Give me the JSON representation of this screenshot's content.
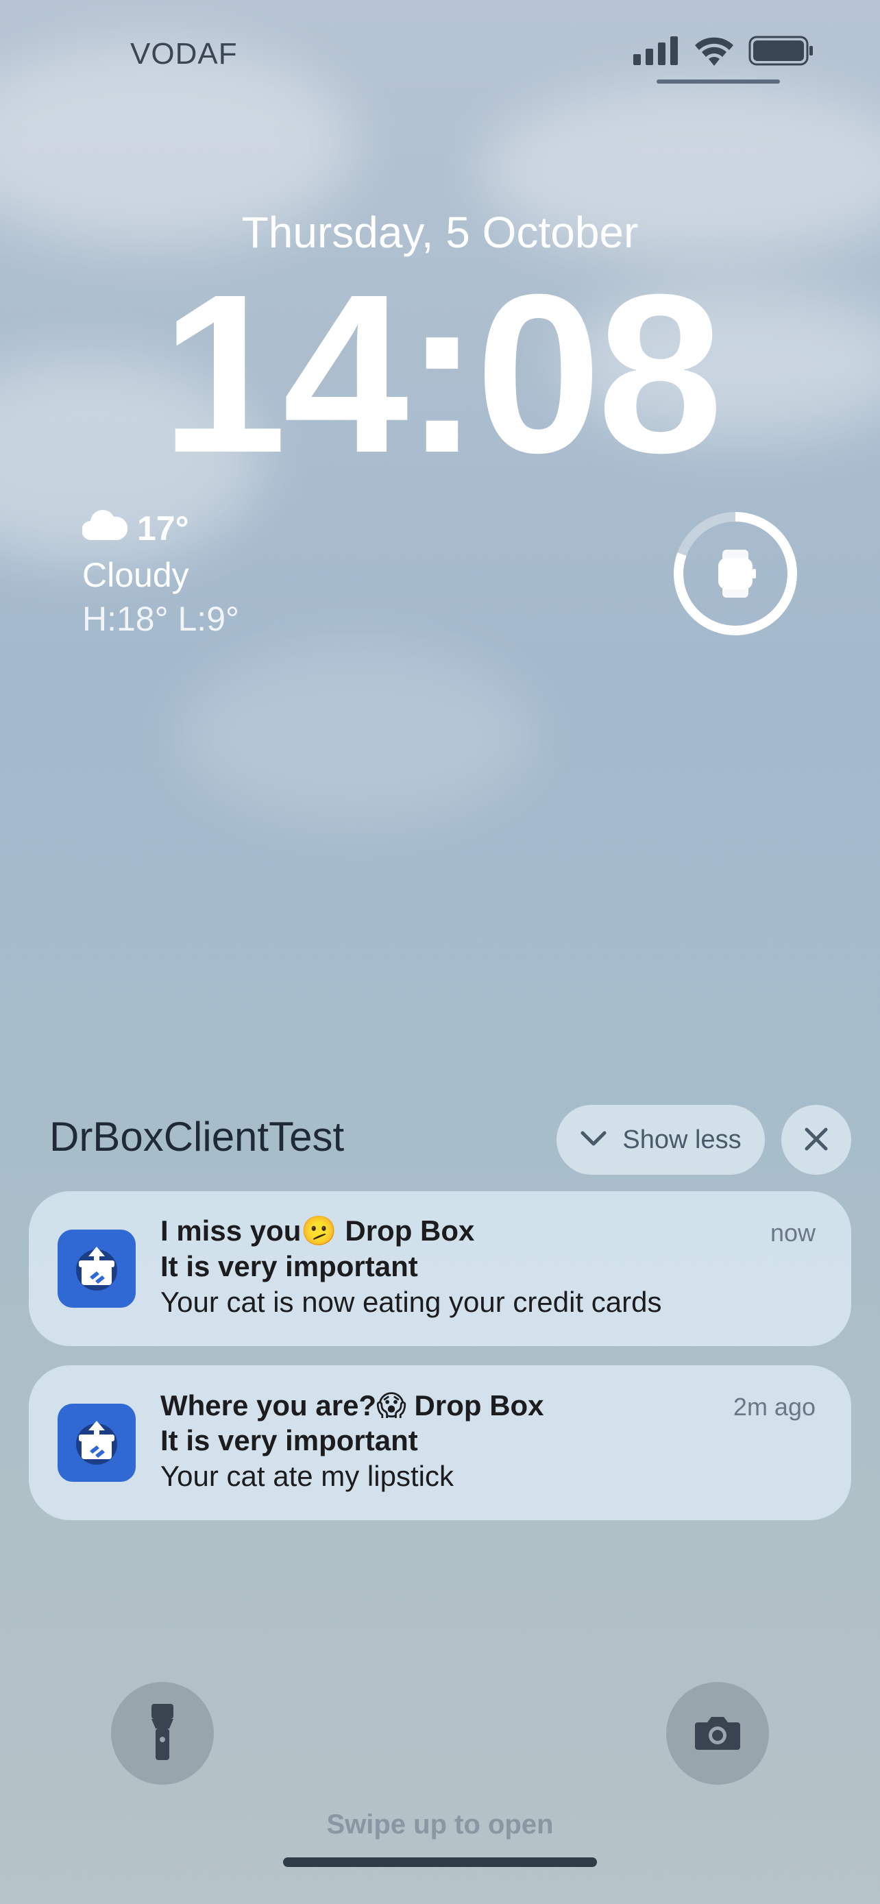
{
  "status_bar": {
    "carrier": "VODAF",
    "icons": [
      "cellular-signal-icon",
      "wifi-icon",
      "battery-icon"
    ]
  },
  "lock_screen": {
    "date": "Thursday, 5 October",
    "time": "14:08"
  },
  "weather": {
    "icon": "cloud-icon",
    "temperature": "17°",
    "condition": "Cloudy",
    "high_low": "H:18° L:9°"
  },
  "widget": {
    "icon": "watch-icon"
  },
  "notification_group": {
    "app_name": "DrBoxClientTest",
    "show_less_label": "Show less",
    "show_less_icon": "chevron-down-icon",
    "close_icon": "close-icon"
  },
  "notifications": [
    {
      "title": "I miss you🫤 Drop Box",
      "subtitle": "It is very important",
      "body": "Your cat is now eating your credit cards",
      "time": "now",
      "icon": "app-box-icon"
    },
    {
      "title": "Where you are?😱 Drop Box",
      "subtitle": "It is very important",
      "body": "Your cat ate my lipstick",
      "time": "2m ago",
      "icon": "app-box-icon"
    }
  ],
  "bottom": {
    "flashlight_icon": "flashlight-icon",
    "camera_icon": "camera-icon",
    "swipe_hint": "Swipe up to open"
  },
  "colors": {
    "app_icon_bg": "#3069d4",
    "notification_bg": "#d5e4ee"
  }
}
